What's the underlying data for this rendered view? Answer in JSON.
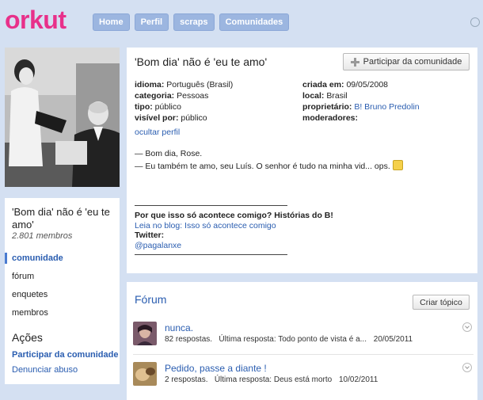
{
  "header": {
    "logo": "orkut",
    "nav": [
      "Home",
      "Perfil",
      "scraps",
      "Comunidades"
    ]
  },
  "sidebar": {
    "community_name": "'Bom dia' não é 'eu te amo'",
    "members": "2.801 membros",
    "menu": [
      "comunidade",
      "fórum",
      "enquetes",
      "membros"
    ],
    "actions_title": "Ações",
    "join_link": "Participar da comunidade",
    "report_link": "Denunciar abuso"
  },
  "main": {
    "title": "'Bom dia' não é 'eu te amo'",
    "join_button": "Participar da comunidade",
    "meta_left": [
      {
        "label": "idioma:",
        "value": "Português (Brasil)"
      },
      {
        "label": "categoria:",
        "value": "Pessoas"
      },
      {
        "label": "tipo:",
        "value": "público"
      },
      {
        "label": "visível por:",
        "value": "público"
      }
    ],
    "meta_right": [
      {
        "label": "criada em:",
        "value": "09/05/2008"
      },
      {
        "label": "local:",
        "value": "Brasil"
      },
      {
        "label": "proprietário:",
        "value": "B! Bruno Predolin"
      },
      {
        "label": "moderadores:",
        "value": ""
      }
    ],
    "hide_profile": "ocultar perfil",
    "post_lines": [
      "— Bom dia, Rose.",
      "— Eu também te amo, seu Luís. O senhor é tudo na minha vid... ops."
    ],
    "why_title": "Por que isso só acontece comigo? Histórias do B!",
    "blog_link": "Leia no blog: Isso só acontece comigo",
    "twitter_label": "Twitter:",
    "twitter_handle": "@pagalanxe"
  },
  "forum": {
    "title": "Fórum",
    "create_button": "Criar tópico",
    "topics": [
      {
        "title": "nunca.",
        "replies": "82 respostas.",
        "last": "Última resposta: Todo ponto de vista é a...",
        "date": "20/05/2011"
      },
      {
        "title": "Pedido, passe a diante !",
        "replies": "2 respostas.",
        "last": "Última resposta: Deus está morto",
        "date": "10/02/2011"
      }
    ]
  },
  "colors": {
    "background": "#d4e0f2",
    "logo": "#e8308a",
    "nav_button": "#9cb6e0",
    "link": "#2a5db0"
  }
}
